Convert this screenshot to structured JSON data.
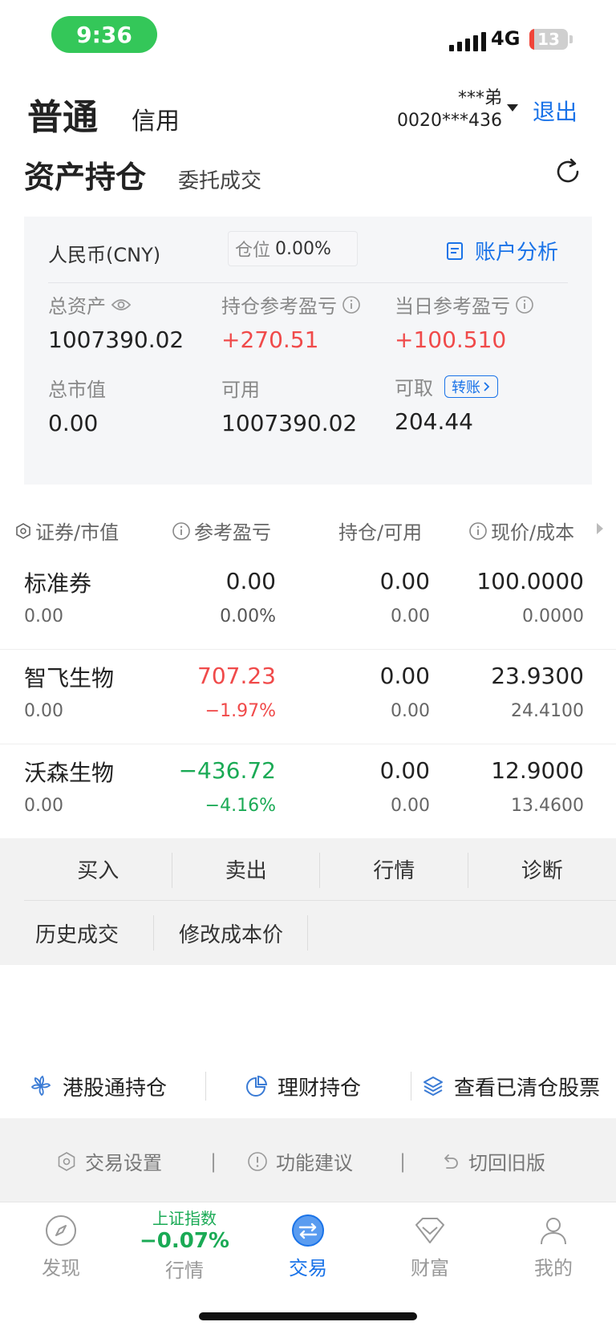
{
  "status_bar": {
    "time": "9:36",
    "network": "4G",
    "battery_level": "13",
    "battery_fraction": 0.13
  },
  "header": {
    "account_tabs": [
      "普通",
      "信用"
    ],
    "account_name": "***弟",
    "account_id": "0020***436",
    "logout_label": "退出"
  },
  "sub_tabs": [
    "资产持仓",
    "委托成交"
  ],
  "summary": {
    "currency": "人民币(CNY)",
    "position_label": "仓位",
    "position_value": "0.00%",
    "analysis_label": "账户分析",
    "total_assets_label": "总资产",
    "total_assets": "1007390.02",
    "holding_pl_label": "持仓参考盈亏",
    "holding_pl": "+270.51",
    "daily_pl_label": "当日参考盈亏",
    "daily_pl": "+100.510",
    "market_value_label": "总市值",
    "market_value": "0.00",
    "available_label": "可用",
    "available": "1007390.02",
    "withdrawable_label": "可取",
    "transfer_label": "转账",
    "withdrawable": "204.44"
  },
  "table": {
    "headers": [
      "证券/市值",
      "参考盈亏",
      "持仓/可用",
      "现价/成本"
    ],
    "rows": [
      {
        "name": "标准券",
        "market_value": "0.00",
        "pl": "0.00",
        "pl_pct": "0.00%",
        "position": "0.00",
        "available": "0.00",
        "price": "100.0000",
        "cost": "0.0000",
        "trend": "flat"
      },
      {
        "name": "智飞生物",
        "market_value": "0.00",
        "pl": "707.23",
        "pl_pct": "−1.97%",
        "position": "0.00",
        "available": "0.00",
        "price": "23.9300",
        "cost": "24.4100",
        "trend": "up"
      },
      {
        "name": "沃森生物",
        "market_value": "0.00",
        "pl": "−436.72",
        "pl_pct": "−4.16%",
        "position": "0.00",
        "available": "0.00",
        "price": "12.9000",
        "cost": "13.4600",
        "trend": "down"
      }
    ]
  },
  "actions": {
    "row1": [
      "买入",
      "卖出",
      "行情",
      "诊断"
    ],
    "row2": [
      "历史成交",
      "修改成本价"
    ]
  },
  "extras": [
    "港股通持仓",
    "理财持仓",
    "查看已清仓股票"
  ],
  "settings": [
    "交易设置",
    "功能建议",
    "切回旧版"
  ],
  "settings_separator": "|",
  "bottom_nav": {
    "discover": "发现",
    "market": "行情",
    "index_name": "上证指数",
    "index_value": "−0.07%",
    "trade": "交易",
    "wealth": "财富",
    "mine": "我的"
  },
  "colors": {
    "accent": "#1a73e8",
    "up": "#f04a4a",
    "down": "#1aaa55",
    "status_green": "#34c759"
  },
  "icons": [
    "refresh-icon",
    "eye-icon",
    "info-icon",
    "document-icon",
    "chevron-right-icon",
    "hk-flower-icon",
    "pie-chart-icon",
    "layers-icon",
    "gear-icon",
    "alert-icon",
    "undo-icon",
    "compass-icon",
    "exchange-icon",
    "diamond-icon",
    "user-icon"
  ]
}
